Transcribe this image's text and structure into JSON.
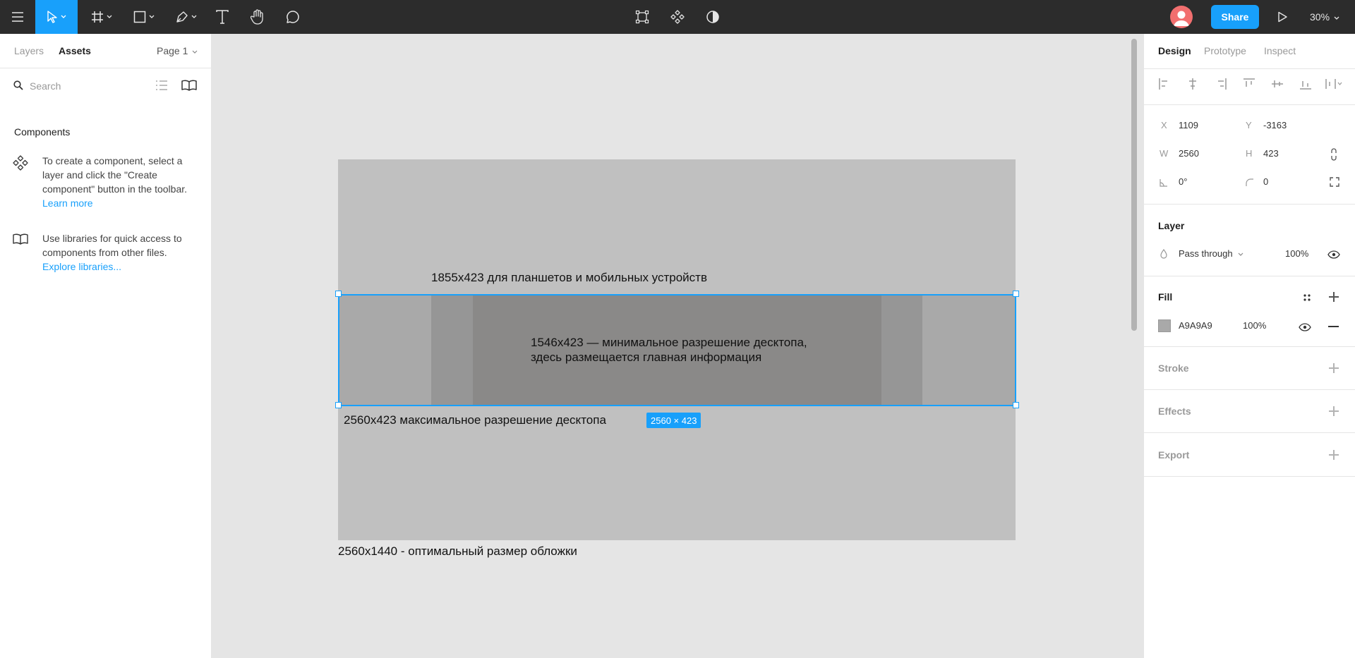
{
  "toolbar": {
    "menu_icon": "hamburger-icon",
    "tools": [
      "move-tool",
      "frame-tool",
      "shape-tool",
      "pen-tool",
      "text-tool",
      "hand-tool",
      "comment-tool"
    ],
    "center_tools": [
      "edit-object",
      "components",
      "mask"
    ],
    "share_label": "Share",
    "zoom": "30%"
  },
  "left_panel": {
    "tabs": [
      "Layers",
      "Assets"
    ],
    "active_tab": "Assets",
    "page_selector": "Page 1",
    "search_placeholder": "Search",
    "components_title": "Components",
    "component_hint": "To create a component, select a layer and click the \"Create component\" button in the toolbar.",
    "learn_more": "Learn more",
    "library_hint": "Use libraries for quick access to components from other files.",
    "explore_libraries": "Explore libraries..."
  },
  "canvas": {
    "label_tablet": "1855x423 для планшетов и мобильных устройств",
    "label_min_line1": "1546x423 — минимальное разрешение десктопа,",
    "label_min_line2": "здесь размещается главная информация",
    "label_max": "2560x423 максимальное разрешение десктопа",
    "size_badge": "2560 × 423",
    "label_cover": "2560x1440 - оптимальный размер обложки",
    "help": "?"
  },
  "right_panel": {
    "tabs": [
      "Design",
      "Prototype",
      "Inspect"
    ],
    "active_tab": "Design",
    "x_label": "X",
    "x_value": "1109",
    "y_label": "Y",
    "y_value": "-3163",
    "w_label": "W",
    "w_value": "2560",
    "h_label": "H",
    "h_value": "423",
    "rotation": "0°",
    "radius": "0",
    "layer_title": "Layer",
    "blend_mode": "Pass through",
    "layer_opacity": "100%",
    "fill_title": "Fill",
    "fill_hex": "A9A9A9",
    "fill_opacity": "100%",
    "stroke_title": "Stroke",
    "effects_title": "Effects",
    "export_title": "Export"
  },
  "colors": {
    "accent": "#18a0fb",
    "toolbar_bg": "#2c2c2c",
    "canvas_bg": "#e5e5e5",
    "cover_fill": "#c0c0c0",
    "selected_fill": "#a9a9a9"
  }
}
